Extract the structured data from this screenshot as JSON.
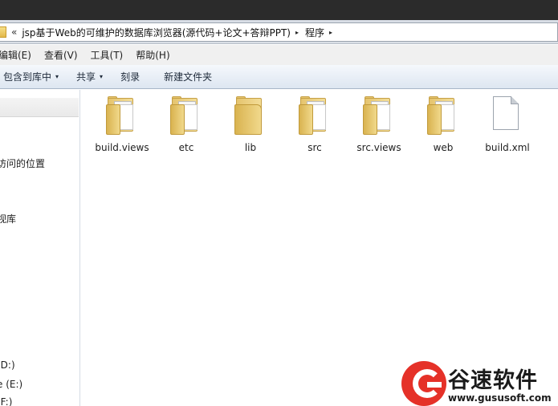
{
  "address": {
    "overflow_glyph": "«",
    "segments": [
      "jsp基于Web的可维护的数据库浏览器(源代码+论文+答辩PPT)",
      "程序"
    ],
    "separator_glyph": "▸"
  },
  "menubar": {
    "items": [
      "编辑(E)",
      "查看(V)",
      "工具(T)",
      "帮助(H)"
    ]
  },
  "toolbar": {
    "items": [
      {
        "label": "包含到库中",
        "dropdown": "▾"
      },
      {
        "label": "共享",
        "dropdown": "▾"
      },
      {
        "label": "刻录"
      },
      {
        "label": "新建文件夹"
      }
    ]
  },
  "nav": {
    "items": [
      "访问的位置",
      "视库",
      "(D:)",
      "e (E:)",
      "(F:)"
    ]
  },
  "files": [
    {
      "name": "build.views",
      "icon": "folder-with-files-icon"
    },
    {
      "name": "etc",
      "icon": "folder-with-files-icon"
    },
    {
      "name": "lib",
      "icon": "folder-icon"
    },
    {
      "name": "src",
      "icon": "folder-with-files-icon"
    },
    {
      "name": "src.views",
      "icon": "folder-with-files-icon"
    },
    {
      "name": "web",
      "icon": "folder-with-files-icon"
    },
    {
      "name": "build.xml",
      "icon": "document-icon"
    }
  ],
  "watermark": {
    "title": "谷速软件",
    "url": "www.gususoft.com",
    "color": "#e53128"
  }
}
